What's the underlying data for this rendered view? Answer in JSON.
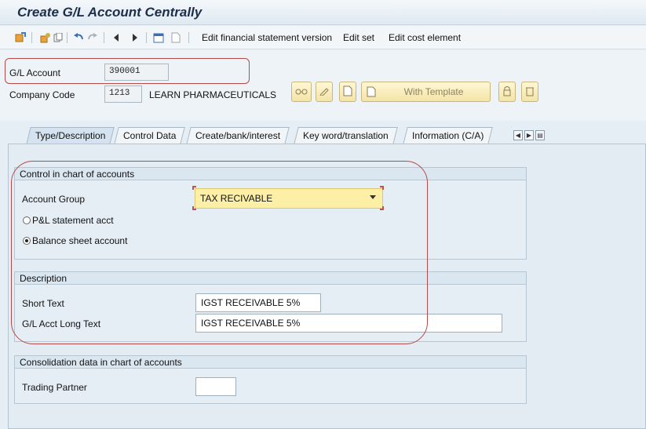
{
  "window": {
    "title": "Create G/L Account Centrally"
  },
  "toolbar": {
    "items": [
      {
        "label": "Edit financial statement version"
      },
      {
        "label": "Edit set"
      },
      {
        "label": "Edit cost element"
      }
    ]
  },
  "header": {
    "gl_account_label": "G/L Account",
    "gl_account_value": "390001",
    "company_code_label": "Company Code",
    "company_code_value": "1213",
    "company_name": "LEARN PHARMACEUTICALS",
    "with_template_label": "With Template"
  },
  "tabs": [
    {
      "label": "Type/Description",
      "active": true
    },
    {
      "label": "Control Data"
    },
    {
      "label": "Create/bank/interest"
    },
    {
      "label": "Key word/translation"
    },
    {
      "label": "Information (C/A)"
    }
  ],
  "control_group": {
    "title": "Control in chart of accounts",
    "account_group_label": "Account Group",
    "account_group_value": "TAX RECIVABLE",
    "radio_pl": "P&L statement acct",
    "radio_balance": "Balance sheet account",
    "selected": "balance"
  },
  "description_group": {
    "title": "Description",
    "short_text_label": "Short Text",
    "short_text_value": "IGST RECEIVABLE 5%",
    "long_text_label": "G/L Acct Long Text",
    "long_text_value": "IGST RECEIVABLE 5%"
  },
  "consolidation_group": {
    "title": "Consolidation data in chart of accounts",
    "trading_partner_label": "Trading Partner",
    "trading_partner_value": ""
  },
  "colors": {
    "highlight": "#b54a4a",
    "dropdown_bg": "#fdf0a6"
  }
}
